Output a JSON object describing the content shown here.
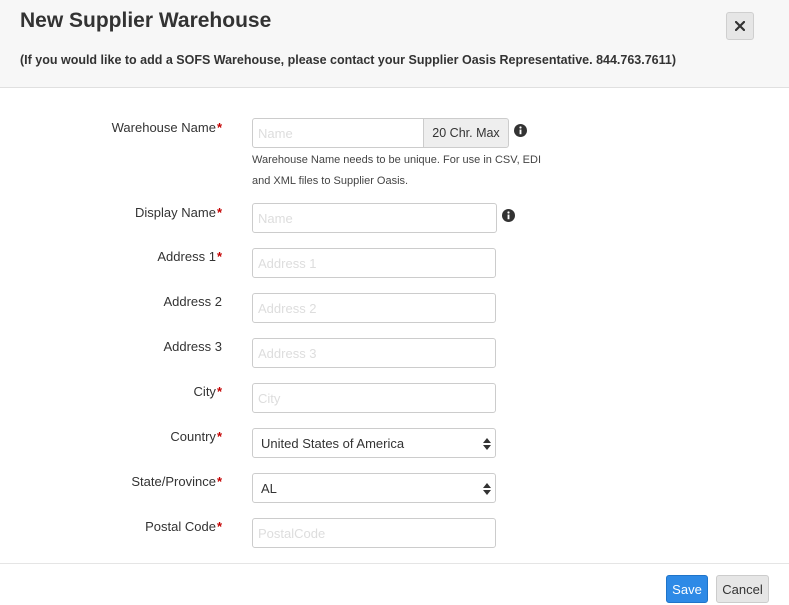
{
  "header": {
    "title": "New Supplier Warehouse",
    "subtitle": "(If you would like to add a SOFS Warehouse, please contact your Supplier Oasis Representative. 844.763.7611)",
    "close_icon": "close-icon"
  },
  "form": {
    "required_marker": "*",
    "warehouse_name": {
      "label": "Warehouse Name",
      "placeholder": "Name",
      "value": "",
      "addon": "20 Chr. Max",
      "help_line1": "Warehouse Name needs to be unique. For use in CSV, EDI",
      "help_line2": "and XML files to Supplier Oasis.",
      "icon": "info-icon"
    },
    "display_name": {
      "label": "Display Name",
      "placeholder": "Name",
      "value": "",
      "icon": "info-icon"
    },
    "address1": {
      "label": "Address 1",
      "placeholder": "Address 1",
      "value": ""
    },
    "address2": {
      "label": "Address 2",
      "placeholder": "Address 2",
      "value": ""
    },
    "address3": {
      "label": "Address 3",
      "placeholder": "Address 3",
      "value": ""
    },
    "city": {
      "label": "City",
      "placeholder": "City",
      "value": ""
    },
    "country": {
      "label": "Country",
      "selected": "United States of America"
    },
    "state": {
      "label": "State/Province",
      "selected": "AL"
    },
    "postal": {
      "label": "Postal Code",
      "placeholder": "PostalCode",
      "value": ""
    }
  },
  "footer": {
    "save_label": "Save",
    "cancel_label": "Cancel"
  },
  "colors": {
    "primary": "#2e8ae6",
    "required": "#c40000",
    "header_bg": "#f7f7f7"
  }
}
